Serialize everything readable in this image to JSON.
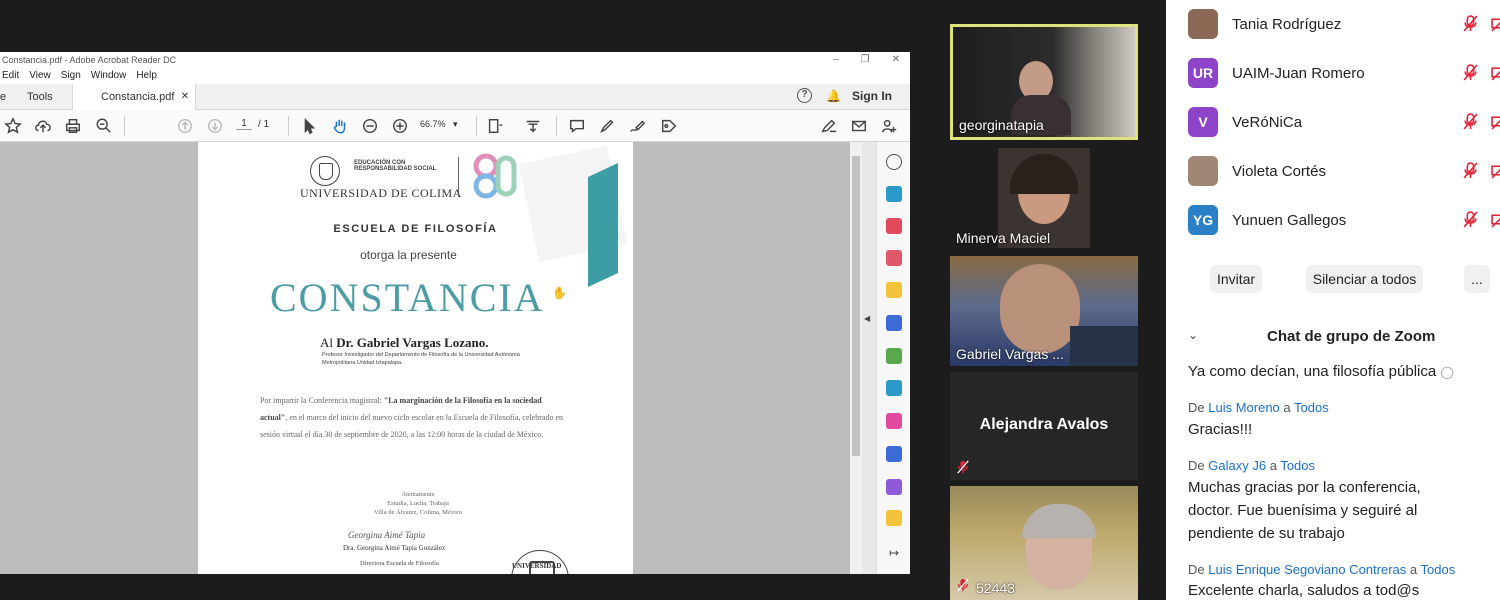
{
  "acrobat": {
    "title": "Constancia.pdf - Adobe Acrobat Reader DC",
    "menu": [
      "Edit",
      "View",
      "Sign",
      "Window",
      "Help"
    ],
    "tabs": {
      "home": "e",
      "tools": "Tools",
      "doc": "Constancia.pdf"
    },
    "sign_in": "Sign In",
    "page_current": "1",
    "page_total": "/ 1",
    "zoom": "66.7%"
  },
  "document": {
    "uni_tag": "EDUCACIÓN CON RESPONSABILIDAD SOCIAL",
    "uni_name": "UNIVERSIDAD DE COLIMA",
    "escuela": "ESCUELA DE FILOSOFÍA",
    "otorga": "otorga la presente",
    "constancia": "CONSTANCIA",
    "recipient_prefix": "Al",
    "recipient_name": "Dr. Gabriel Vargas Lozano.",
    "recipient_sub": "Profesor Investigador del Departamento de Filosofía de la Universidad Autónoma Metropolitana Unidad Iztapalapa.",
    "body_1": "Por impartir la Conferencia magistral: ",
    "body_bold": "\"La marginación de la Filosofía en la sociedad actual\"",
    "body_2": ", en el marco del inicio del nuevo ciclo escolar en la Escuela de Filosofía, celebrado en sesión virtual el día 30 de septiembre de 2020, a las 12:00 horas de la ciudad de México.",
    "closing": "Atentamente\nEstudia, Lucha, Trabaja\nVilla de Álvarez, Colima, México",
    "signature": "Georgina Aimé Tapia",
    "signer": "Dra. Georgina Aimé Tapia González",
    "signer_title": "Directora Escuela de Filosofía",
    "bottom_uni": "UNIVERSIDAD"
  },
  "video_tiles": [
    {
      "name": "georginatapia"
    },
    {
      "name": "Minerva Maciel"
    },
    {
      "name": "Gabriel Vargas ..."
    },
    {
      "name": "Alejandra Avalos"
    },
    {
      "name": "52443"
    }
  ],
  "participants": [
    {
      "name": "Tania Rodríguez",
      "initials": "",
      "color": "#8a6a55"
    },
    {
      "name": "UAIM-Juan Romero",
      "initials": "UR",
      "color": "#8e44c9"
    },
    {
      "name": "VeRóNiCa",
      "initials": "V",
      "color": "#8e44c9"
    },
    {
      "name": "Violeta Cortés",
      "initials": "",
      "color": "#a08674"
    },
    {
      "name": "Yunuen Gallegos",
      "initials": "YG",
      "color": "#2a7fc6"
    }
  ],
  "panel_buttons": {
    "invite": "Invitar",
    "mute_all": "Silenciar a todos",
    "more": "..."
  },
  "chat": {
    "header": "Chat de grupo de Zoom",
    "first_line": "Ya como decían, una filosofía pública",
    "messages": [
      {
        "from": "Luis Moreno",
        "to": "Todos",
        "text": "Gracias!!!"
      },
      {
        "from": "Galaxy J6",
        "to": "Todos",
        "text": "Muchas gracias por la conferencia, doctor. Fue buenísima y seguiré al pendiente de su trabajo"
      },
      {
        "from": "Luis Enrique Segoviano Contreras",
        "to": "Todos",
        "text": "Excelente charla, saludos a tod@s"
      }
    ],
    "de": "De",
    "a": "a"
  },
  "colors": {
    "teal": "#4b9ca5",
    "link": "#1b6fc9",
    "mute_red": "#e0243a",
    "active_border": "#dde27a"
  }
}
